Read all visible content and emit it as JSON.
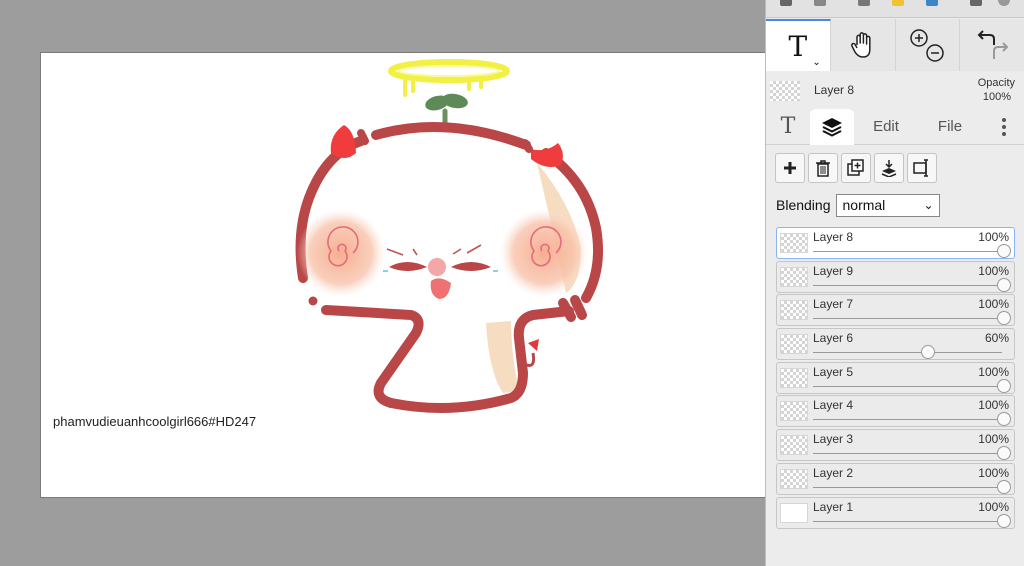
{
  "canvas": {
    "signature": "phamvudieuanhcoolgirl666#HD247"
  },
  "toolbar": {
    "tools": [
      {
        "name": "text-tool",
        "icon": "text-T-icon",
        "glyph": "T"
      },
      {
        "name": "hand-tool",
        "icon": "hand-icon"
      },
      {
        "name": "zoom-tool",
        "icon": "zoom-in-out-icon"
      },
      {
        "name": "undo-redo",
        "icon": "undo-redo-icon"
      }
    ]
  },
  "current_layer": {
    "name": "Layer 8",
    "opacity_label": "Opacity",
    "opacity_value": "100%"
  },
  "tabs": {
    "text": "T",
    "layers_icon": "layers-icon",
    "edit": "Edit",
    "file": "File",
    "more_icon": "more-vertical-icon"
  },
  "layer_actions": [
    "add-layer-icon",
    "delete-layer-icon",
    "duplicate-layer-icon",
    "merge-down-icon",
    "layer-properties-icon"
  ],
  "blending": {
    "label": "Blending",
    "value": "normal"
  },
  "layers": [
    {
      "name": "Layer 8",
      "opacity": "100%",
      "level": 1.0,
      "active": true
    },
    {
      "name": "Layer 9",
      "opacity": "100%",
      "level": 1.0
    },
    {
      "name": "Layer 7",
      "opacity": "100%",
      "level": 1.0
    },
    {
      "name": "Layer 6",
      "opacity": "60%",
      "level": 0.6
    },
    {
      "name": "Layer 5",
      "opacity": "100%",
      "level": 1.0
    },
    {
      "name": "Layer 4",
      "opacity": "100%",
      "level": 1.0
    },
    {
      "name": "Layer 3",
      "opacity": "100%",
      "level": 1.0
    },
    {
      "name": "Layer 2",
      "opacity": "100%",
      "level": 1.0
    },
    {
      "name": "Layer 1",
      "opacity": "100%",
      "level": 1.0
    }
  ],
  "colors": {
    "accent": "#4a86e8",
    "outline": "#b94a4a",
    "horn": "#f03c3c",
    "halo": "#f5f05a",
    "blush": "#f7b9a0",
    "sprout": "#5e8a5a"
  }
}
